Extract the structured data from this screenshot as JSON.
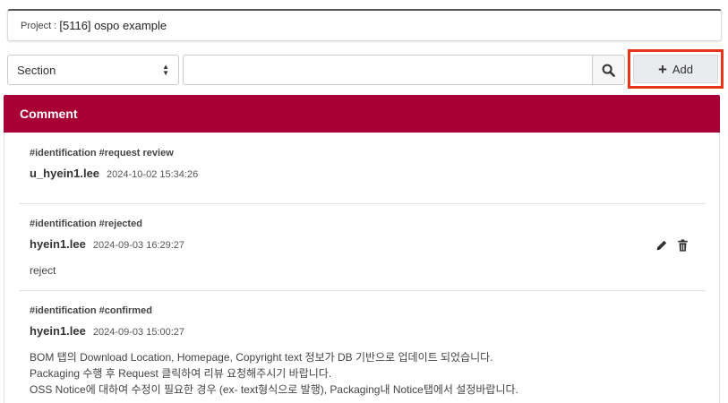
{
  "project": {
    "label": "Project :",
    "value": "[5116] ospo example"
  },
  "toolbar": {
    "section_select": "Section",
    "search_value": "",
    "add_label": "Add"
  },
  "comments": {
    "header": "Comment",
    "items": [
      {
        "tags": "#identification #request review",
        "author": "u_hyein1.lee",
        "date": "2024-10-02 15:34:26",
        "lines": []
      },
      {
        "tags": "#identification #rejected",
        "author": "hyein1.lee",
        "date": "2024-09-03 16:29:27",
        "lines": [
          "reject"
        ]
      },
      {
        "tags": "#identification #confirmed",
        "author": "hyein1.lee",
        "date": "2024-09-03 15:00:27",
        "lines": [
          "BOM 탭의 Download Location, Homepage, Copyright text 정보가 DB 기반으로 업데이트 되었습니다.",
          "Packaging 수행 후 Request 클릭하여 리뷰 요청해주시기 바랍니다.",
          "OSS Notice에 대하여 수정이 필요한 경우 (ex- text형식으로 발행), Packaging내 Notice탭에서 설정바랍니다."
        ]
      }
    ]
  },
  "icons": {
    "search": "search-icon",
    "edit": "pencil-icon",
    "delete": "trash-icon",
    "add": "plus-icon"
  }
}
